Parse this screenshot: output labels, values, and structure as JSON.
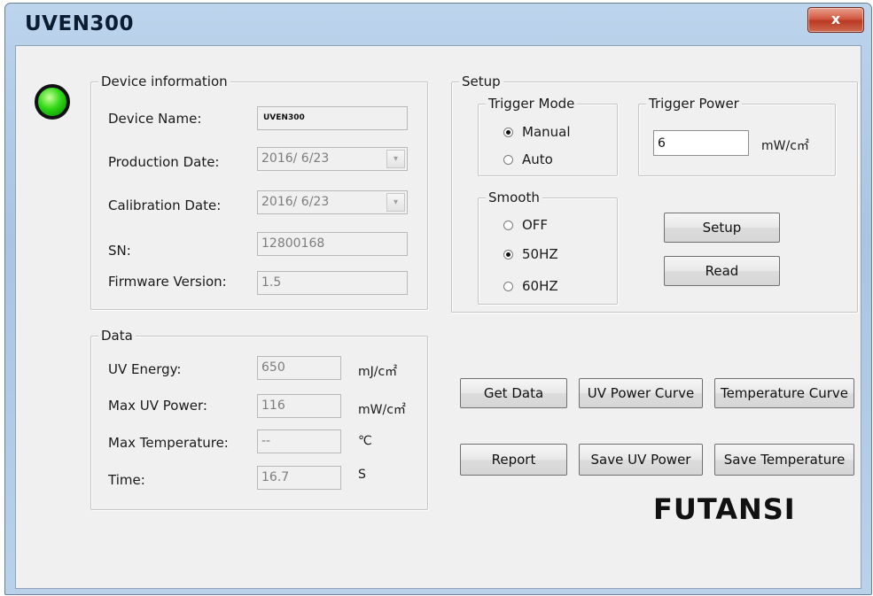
{
  "window": {
    "title": "UVEN300",
    "close_glyph": "x"
  },
  "status": {
    "led_color": "#2fd815",
    "led_icon": "status-led"
  },
  "device_info": {
    "legend": "Device information",
    "device_name_label": "Device Name:",
    "device_name_value": "UVEN300",
    "production_date_label": "Production Date:",
    "production_date_value": "2016/  6/23",
    "calibration_date_label": "Calibration Date:",
    "calibration_date_value": "2016/  6/23",
    "sn_label": "SN:",
    "sn_value": "12800168",
    "firmware_label": "Firmware Version:",
    "firmware_value": "1.5",
    "dropdown_arrow": "▾"
  },
  "data": {
    "legend": "Data",
    "uv_energy_label": "UV Energy:",
    "uv_energy_value": "650",
    "uv_energy_unit": "mJ/c㎡",
    "max_uv_power_label": "Max UV Power:",
    "max_uv_power_value": "116",
    "max_uv_power_unit": "mW/c㎡",
    "max_temp_label": "Max Temperature:",
    "max_temp_value": "--",
    "max_temp_unit": "℃",
    "time_label": "Time:",
    "time_value": "16.7",
    "time_unit": "S"
  },
  "setup": {
    "legend": "Setup",
    "trigger_mode": {
      "legend": "Trigger Mode",
      "options": [
        {
          "label": "Manual",
          "selected": true
        },
        {
          "label": "Auto",
          "selected": false
        }
      ]
    },
    "trigger_power": {
      "legend": "Trigger Power",
      "value": "6",
      "unit": "mW/c㎡"
    },
    "smooth": {
      "legend": "Smooth",
      "options": [
        {
          "label": "OFF",
          "selected": false
        },
        {
          "label": "50HZ",
          "selected": true
        },
        {
          "label": "60HZ",
          "selected": false
        }
      ]
    },
    "setup_button": "Setup",
    "read_button": "Read"
  },
  "actions": {
    "get_data": "Get Data",
    "uv_power_curve": "UV Power Curve",
    "temperature_curve": "Temperature Curve",
    "report": "Report",
    "save_uv_power": "Save UV Power",
    "save_temperature": "Save Temperature"
  },
  "brand": "FUTANSI"
}
